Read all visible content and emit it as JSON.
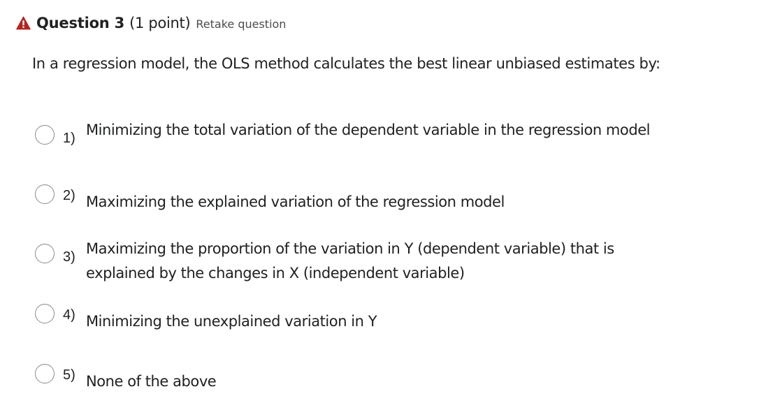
{
  "question": {
    "title": "Question 3",
    "points": "(1 point)",
    "retake_label": "Retake question",
    "text": "In a regression model, the OLS method calculates the best linear unbiased estimates by:",
    "status_icon": "warning-triangle-icon",
    "status_color": "#b5231f"
  },
  "options": [
    {
      "number": "1)",
      "text": "Minimizing the total variation of the dependent variable in the regression model"
    },
    {
      "number": "2)",
      "text": "Maximizing the explained variation of the regression model"
    },
    {
      "number": "3)",
      "text": "Maximizing the proportion of the variation in Y (dependent variable) that is explained by the changes in X (independent variable)"
    },
    {
      "number": "4)",
      "text": "Minimizing the unexplained variation in Y"
    },
    {
      "number": "5)",
      "text": "None of the above"
    }
  ]
}
